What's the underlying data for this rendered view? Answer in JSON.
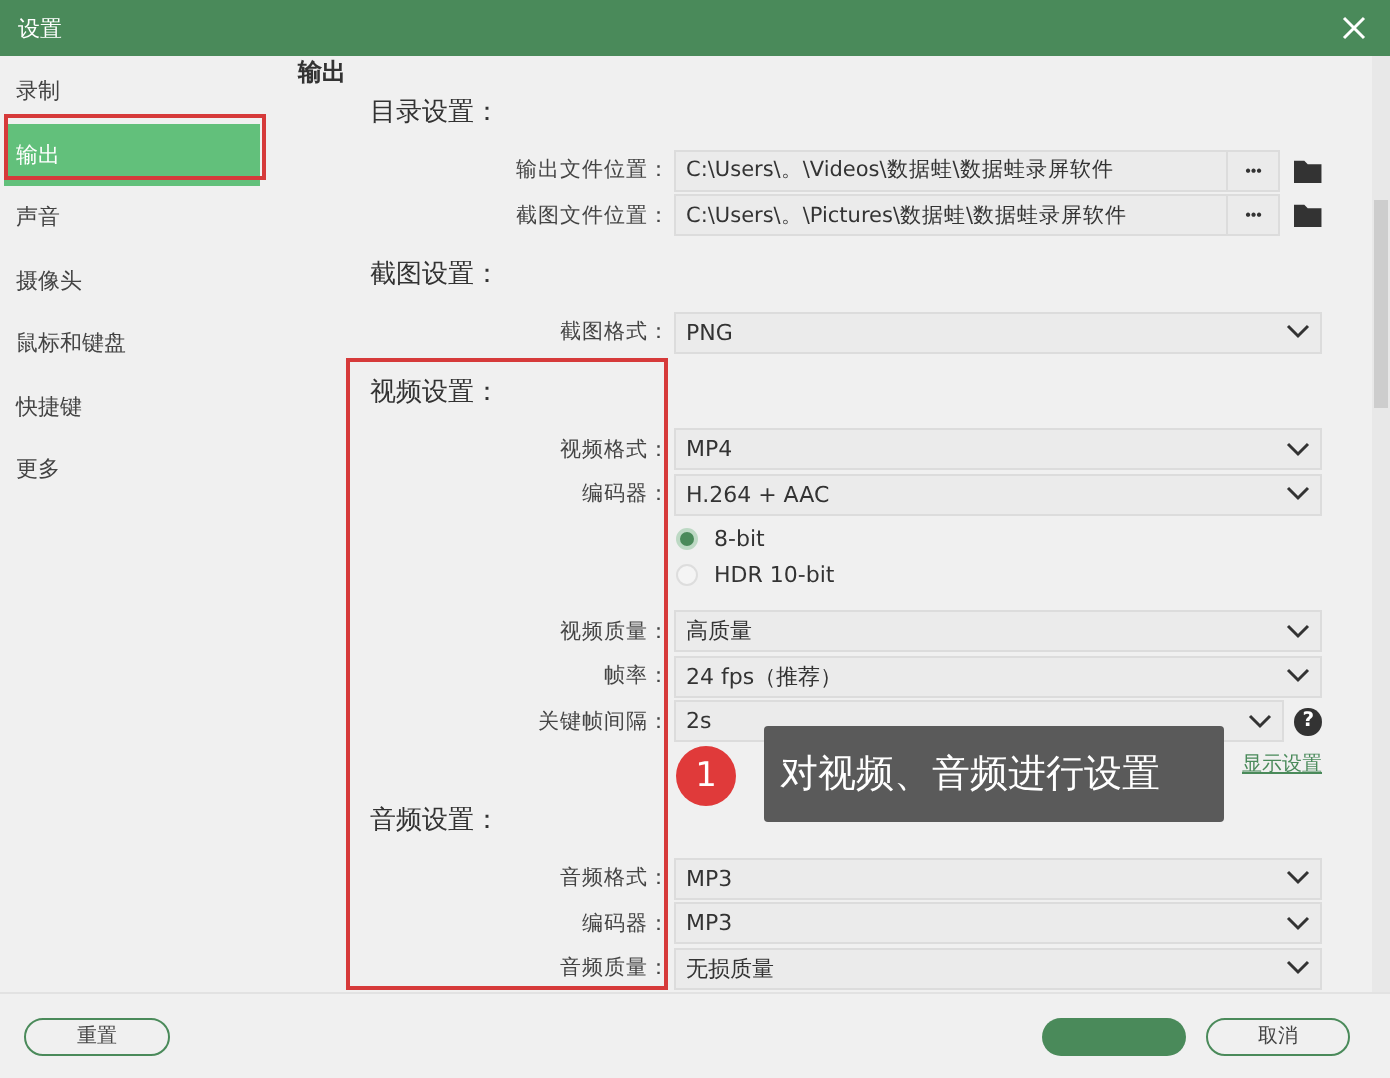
{
  "window": {
    "title": "设置"
  },
  "sidebar": {
    "items": [
      {
        "label": "录制",
        "selected": false
      },
      {
        "label": "输出",
        "selected": true
      },
      {
        "label": "声音",
        "selected": false
      },
      {
        "label": "摄像头",
        "selected": false
      },
      {
        "label": "鼠标和键盘",
        "selected": false
      },
      {
        "label": "快捷键",
        "selected": false
      },
      {
        "label": "更多",
        "selected": false
      }
    ]
  },
  "page_heading": "输出",
  "sections": [
    {
      "title": "目录设置：",
      "rows": [
        {
          "kind": "path",
          "label": "输出文件位置：",
          "value": "C:\\Users\\。\\Videos\\数据蛙\\数据蛙录屏软件",
          "button": "•••"
        },
        {
          "kind": "path",
          "label": "截图文件位置：",
          "value": "C:\\Users\\。\\Pictures\\数据蛙\\数据蛙录屏软件",
          "button": "•••"
        }
      ]
    },
    {
      "title": "截图设置：",
      "rows": [
        {
          "kind": "select",
          "label": "截图格式：",
          "value": "PNG"
        }
      ]
    },
    {
      "title": "视频设置：",
      "rows": [
        {
          "kind": "select",
          "label": "视频格式：",
          "value": "MP4"
        },
        {
          "kind": "select",
          "label": "编码器：",
          "value": "H.264 + AAC"
        },
        {
          "kind": "radio",
          "options": [
            {
              "label": "8-bit",
              "selected": true
            },
            {
              "label": "HDR 10-bit",
              "selected": false
            }
          ]
        },
        {
          "kind": "select",
          "label": "视频质量：",
          "value": "高质量"
        },
        {
          "kind": "select",
          "label": "帧率：",
          "value": "24 fps（推荐）"
        },
        {
          "kind": "select",
          "label": "关键帧间隔：",
          "value": "2s",
          "help": "?"
        },
        {
          "kind": "link",
          "value": "显示设置"
        }
      ]
    },
    {
      "title": "音频设置：",
      "rows": [
        {
          "kind": "select",
          "label": "音频格式：",
          "value": "MP3"
        },
        {
          "kind": "select",
          "label": "编码器：",
          "value": "MP3"
        },
        {
          "kind": "select",
          "label": "音频质量：",
          "value": "无损质量"
        }
      ]
    }
  ],
  "callout": {
    "number": "1",
    "text": "对视频、音频进行设置"
  },
  "footer": {
    "reset": "重置",
    "cancel": "取消"
  }
}
